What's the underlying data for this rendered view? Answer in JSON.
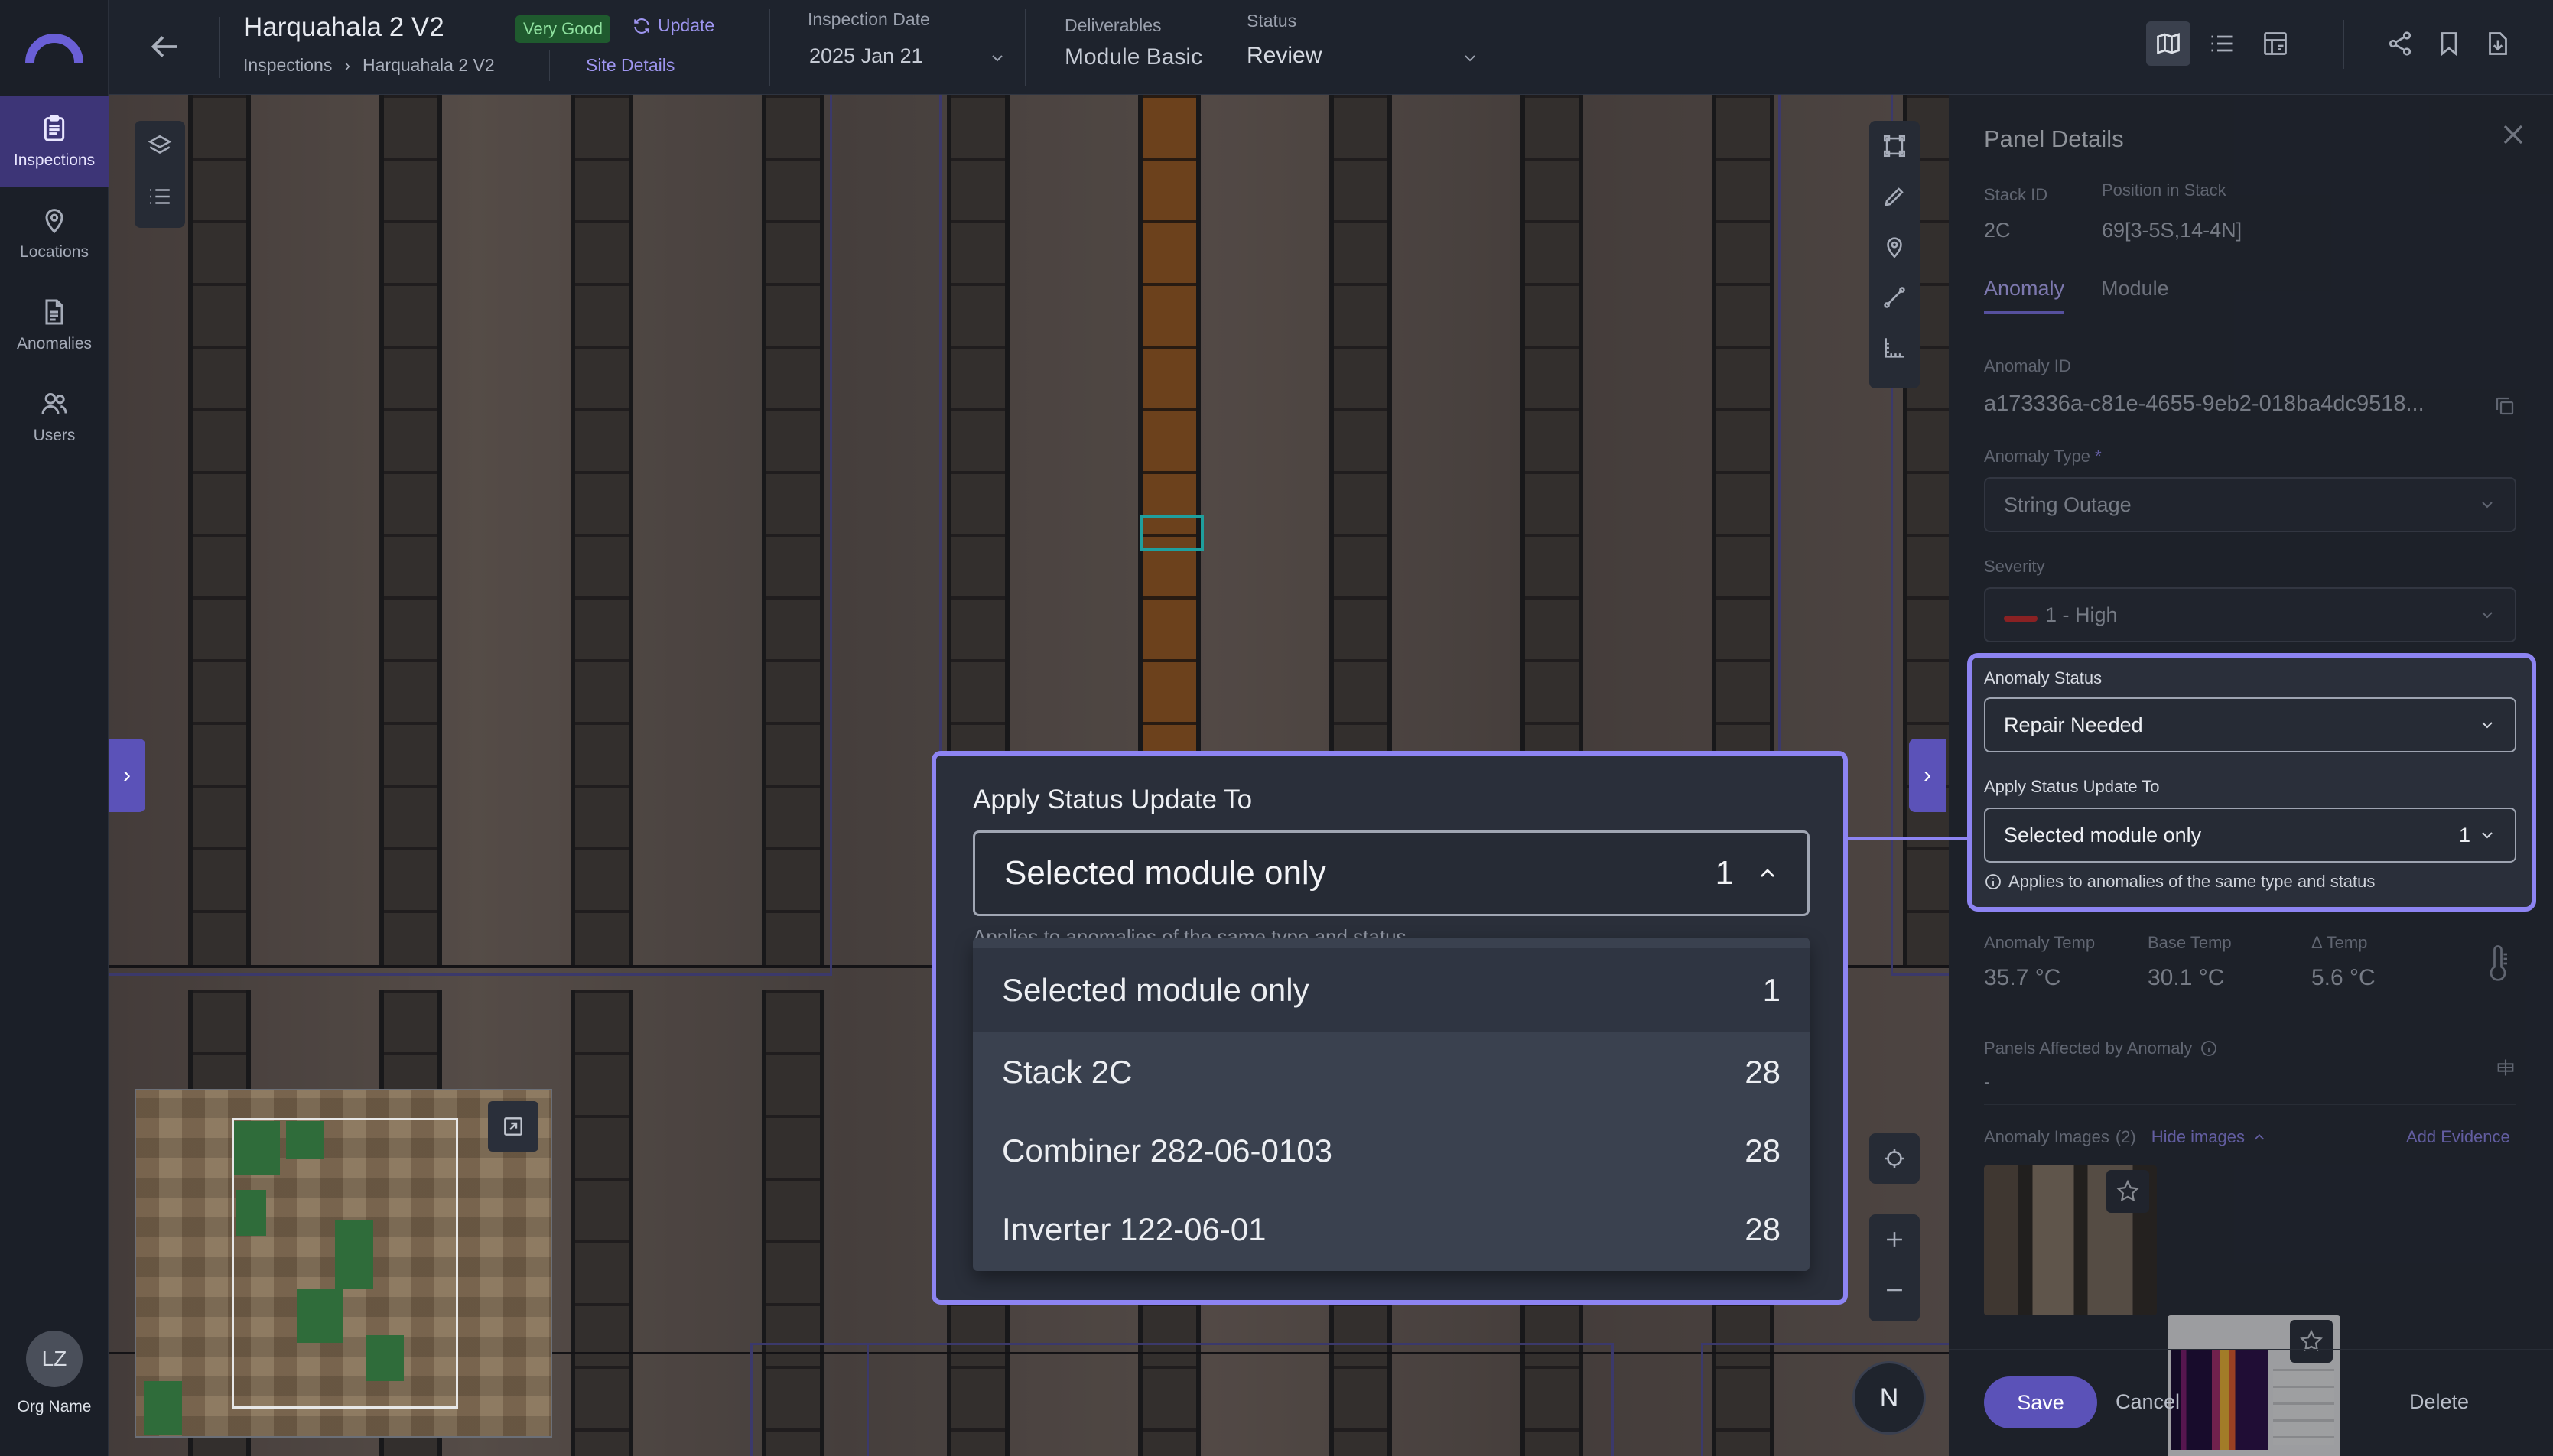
{
  "nav": {
    "items": [
      {
        "label": "Inspections",
        "icon": "clipboard-icon",
        "active": true
      },
      {
        "label": "Locations",
        "icon": "location-pin-icon",
        "active": false
      },
      {
        "label": "Anomalies",
        "icon": "document-icon",
        "active": false
      },
      {
        "label": "Users",
        "icon": "users-icon",
        "active": false
      }
    ],
    "avatar_initials": "LZ",
    "org_name": "Org Name"
  },
  "header": {
    "title": "Harquahala 2 V2",
    "condition_badge": "Very Good",
    "update_label": "Update",
    "breadcrumb": [
      "Inspections",
      "Harquahala 2 V2"
    ],
    "site_details": "Site Details",
    "inspection_date_label": "Inspection Date",
    "inspection_date": "2025 Jan 21",
    "deliverables_label": "Deliverables",
    "deliverables": "Module Basic",
    "status_label": "Status",
    "status": "Review"
  },
  "panel": {
    "title": "Panel Details",
    "stack_id_label": "Stack ID",
    "stack_id": "2C",
    "position_label": "Position in Stack",
    "position": "69[3-5S,14-4N]",
    "tabs": [
      "Anomaly",
      "Module"
    ],
    "anomaly_id_label": "Anomaly ID",
    "anomaly_id": "a173336a-c81e-4655-9eb2-018ba4dc9518...",
    "anomaly_type_label": "Anomaly Type",
    "anomaly_type_required": "*",
    "anomaly_type": "String Outage",
    "severity_label": "Severity",
    "severity": "1 - High",
    "anomaly_status_label": "Anomaly Status",
    "anomaly_status": "Repair Needed",
    "apply_label": "Apply Status Update To",
    "apply_value": "Selected module only",
    "apply_count": "1",
    "apply_info": "Applies to anomalies of the same type and status",
    "anomaly_temp_label": "Anomaly Temp",
    "anomaly_temp": "35.7 °C",
    "base_temp_label": "Base Temp",
    "base_temp": "30.1 °C",
    "delta_temp_label": "Δ Temp",
    "delta_temp": "5.6 °C",
    "panels_affected_label": "Panels Affected by Anomaly",
    "panels_affected": "-",
    "images_label": "Anomaly Images",
    "images_count": "(2)",
    "hide_images": "Hide images",
    "add_evidence": "Add Evidence",
    "save": "Save",
    "cancel": "Cancel",
    "delete": "Delete"
  },
  "popup": {
    "label": "Apply Status Update To",
    "selected": "Selected module only",
    "selected_count": "1",
    "peek_text": "Applies to anomalies of the same type and status",
    "options": [
      {
        "label": "Selected module only",
        "count": "1"
      },
      {
        "label": "Stack 2C",
        "count": "28"
      },
      {
        "label": "Combiner 282-06-0103",
        "count": "28"
      },
      {
        "label": "Inverter 122-06-01",
        "count": "28"
      }
    ]
  },
  "map": {
    "compass": "N"
  },
  "colors": {
    "accent": "#8d84f2",
    "brand": "#5b52b8",
    "severity_high": "#cc2a2a",
    "good_badge": "#1f5a2e",
    "selection": "#1f9f9d"
  }
}
